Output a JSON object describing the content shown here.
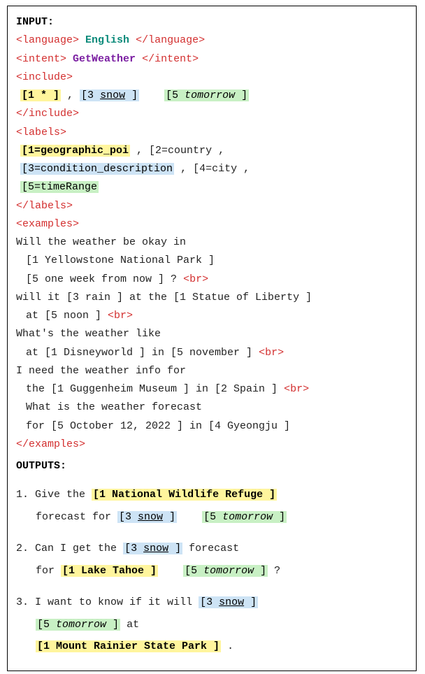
{
  "input_label": "INPUT:",
  "outputs_label": "OUTPUTS:",
  "tags": {
    "lang_open": "<language>",
    "lang_close": "</language>",
    "intent_open": "<intent>",
    "intent_close": "</intent>",
    "include_open": "<include>",
    "include_close": "</include>",
    "labels_open": "<labels>",
    "labels_close": "</labels>",
    "examples_open": "<examples>",
    "examples_close": "</examples>",
    "br": "<br>"
  },
  "language": "English",
  "intent": "GetWeather",
  "include": {
    "slot1": "[1 * ]",
    "slot3_open": "[3 ",
    "slot3_word": "snow",
    "slot3_close": " ]",
    "slot5_open": "[5 ",
    "slot5_word": "tomorrow",
    "slot5_close": " ]"
  },
  "labels": {
    "l1": "[1=geographic_poi",
    "l2": ", [2=country ,",
    "l3": "[3=condition_description",
    "l4": ", [4=city ,",
    "l5": "[5=timeRange"
  },
  "examples": {
    "e1a": "Will the weather be okay in",
    "e1b": "[1 Yellowstone National Park ]",
    "e1c": "[5 one week from now ] ?",
    "e2a": "will it [3 rain ] at the [1 Statue of Liberty ]",
    "e2b": "at [5 noon ]",
    "e3a": "What's the weather like",
    "e3b": "at [1 Disneyworld ] in [5 november ]",
    "e4a": "I need the weather info for",
    "e4b": "the [1 Guggenheim Museum ] in [2 Spain ]",
    "e5a": "What is the weather forecast",
    "e5b": "for [5 October 12, 2022 ] in [4 Gyeongju ]"
  },
  "outputs": {
    "o1": {
      "num": "1.",
      "pre": "Give the ",
      "slot1": "[1 National Wildlife Refuge ]",
      "mid": "forecast for ",
      "slot3o": "[3 ",
      "slot3w": "snow",
      "slot3c": " ]",
      "slot5o": "[5 ",
      "slot5w": "tomorrow",
      "slot5c": " ]"
    },
    "o2": {
      "num": "2.",
      "pre": "Can I get the ",
      "slot3o": "[3 ",
      "slot3w": "snow",
      "slot3c": " ]",
      "mid": " forecast",
      "for": "for ",
      "slot1": "[1 Lake Tahoe ]",
      "slot5o": "[5 ",
      "slot5w": "tomorrow",
      "slot5c": " ]",
      "q": " ?"
    },
    "o3": {
      "num": "3.",
      "pre": "I want to know if it will ",
      "slot3o": "[3 ",
      "slot3w": "snow",
      "slot3c": " ]",
      "slot5o": "[5 ",
      "slot5w": "tomorrow",
      "slot5c": " ]",
      "at": " at",
      "slot1": "[1 Mount Rainier State Park ]",
      "dot": " ."
    }
  }
}
